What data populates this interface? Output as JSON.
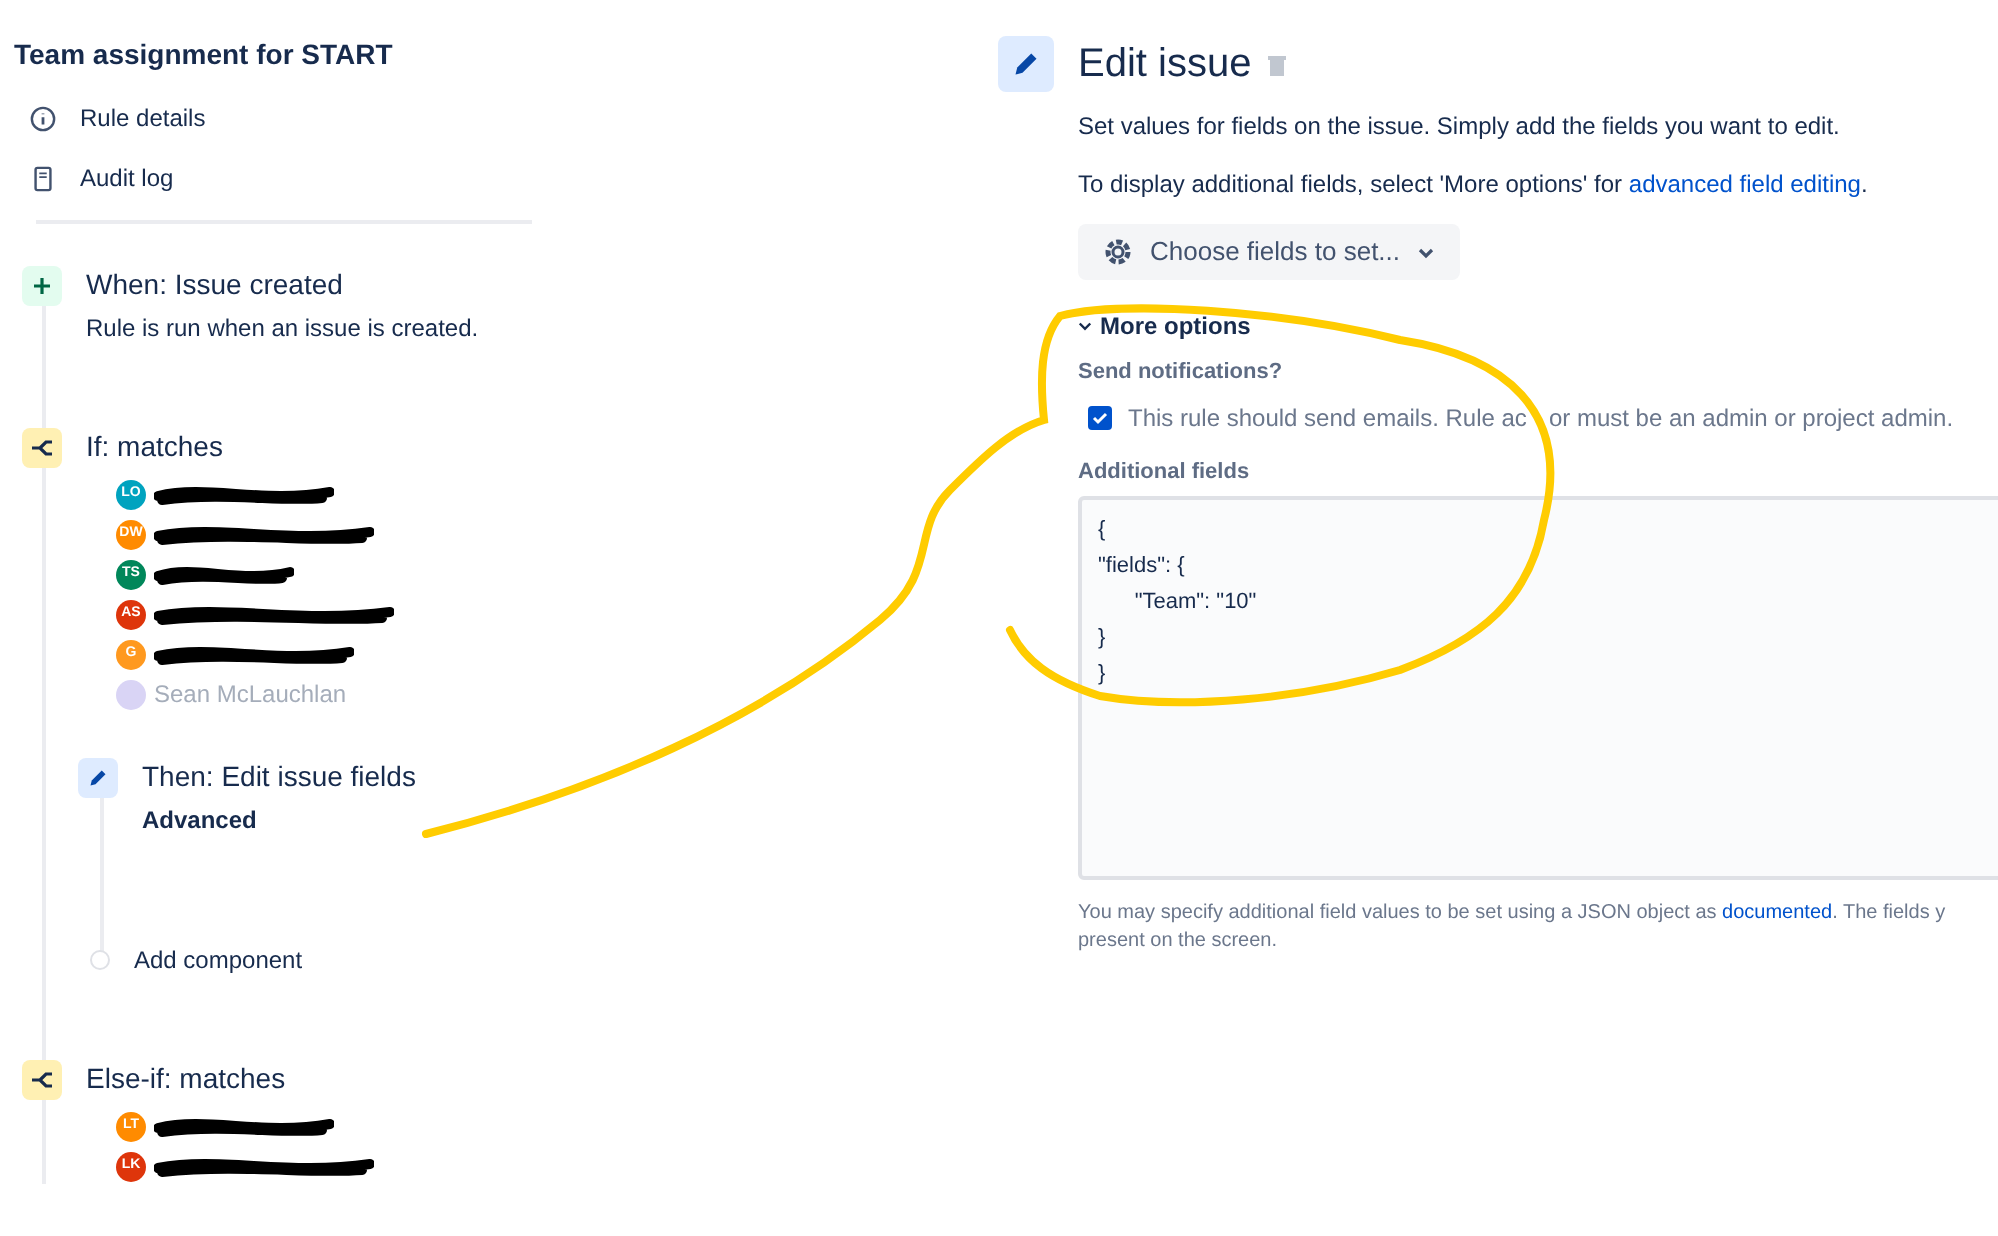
{
  "sidebar": {
    "title": "Team assignment for START",
    "items": [
      {
        "kind": "info",
        "label": "Rule details"
      },
      {
        "kind": "log",
        "label": "Audit log"
      }
    ]
  },
  "flow": [
    {
      "kind": "trigger",
      "title": "When: Issue created",
      "subtitle": "Rule is run when an issue is created."
    },
    {
      "kind": "condition",
      "title": "If: matches",
      "people": [
        {
          "initials": "LO",
          "color": "#00a3bf",
          "redacted": true
        },
        {
          "initials": "DW",
          "color": "#ff8b00",
          "redacted": true
        },
        {
          "initials": "TS",
          "color": "#00875a",
          "redacted": true
        },
        {
          "initials": "AS",
          "color": "#de350b",
          "redacted": true
        },
        {
          "initials": "G",
          "color": "#ff991f",
          "redacted": true
        },
        {
          "color": "#d9d4f5",
          "redacted": false,
          "name": "Sean McLauchlan"
        }
      ],
      "action": {
        "title": "Then: Edit issue fields",
        "subtitle": "Advanced"
      },
      "add": "Add component"
    },
    {
      "kind": "condition",
      "title": "Else-if: matches",
      "people": [
        {
          "initials": "LT",
          "color": "#ff8b00",
          "redacted": true
        },
        {
          "initials": "LK",
          "color": "#de350b",
          "redacted": true
        }
      ]
    }
  ],
  "panel": {
    "title": "Edit issue",
    "description": "Set values for fields on the issue. Simply add the fields you want to edit.",
    "hint_before": "To display additional fields, select 'More options' for ",
    "hint_link": "advanced field editing",
    "hint_after": ".",
    "choose_button": "Choose fields to set...",
    "more_options": {
      "label": "More options",
      "expanded": true
    },
    "notify_label": "Send notifications?",
    "notify": {
      "label": "This rule should send emails. Rule ac",
      "label_rest": "or must be an admin or project admin.",
      "checked": true
    },
    "fields_label": "Additional fields",
    "fields_value": "{\n\"fields\": {\n      \"Team\": \"10\"\n}\n}",
    "help_before": "You may specify additional field values to be set using a JSON object as ",
    "help_link": "documented",
    "help_after": ". The fields y",
    "help_line2": "present on the screen."
  }
}
